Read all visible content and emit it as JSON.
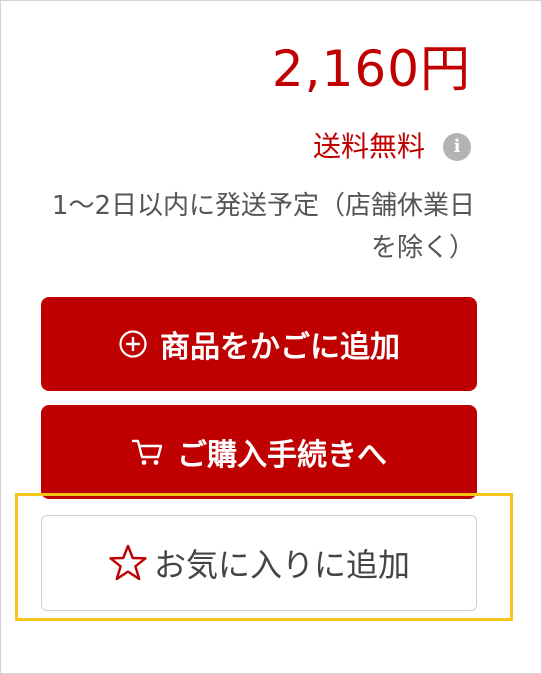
{
  "price": "2,160円",
  "shipping": {
    "label": "送料無料",
    "info_icon": "info-icon"
  },
  "delivery": {
    "text": "1～2日以内に発送予定（店舗休業日を除く）"
  },
  "buttons": {
    "add_to_cart": {
      "label": "商品をかごに追加",
      "icon": "plus-circle-icon"
    },
    "checkout": {
      "label": "ご購入手続きへ",
      "icon": "cart-icon"
    },
    "favorite": {
      "label": "お気に入りに追加",
      "icon": "star-icon"
    }
  },
  "colors": {
    "accent": "#bf0000",
    "highlight": "#f5c518",
    "muted_text": "#555555",
    "info_icon_bg": "#b3b3b3"
  }
}
